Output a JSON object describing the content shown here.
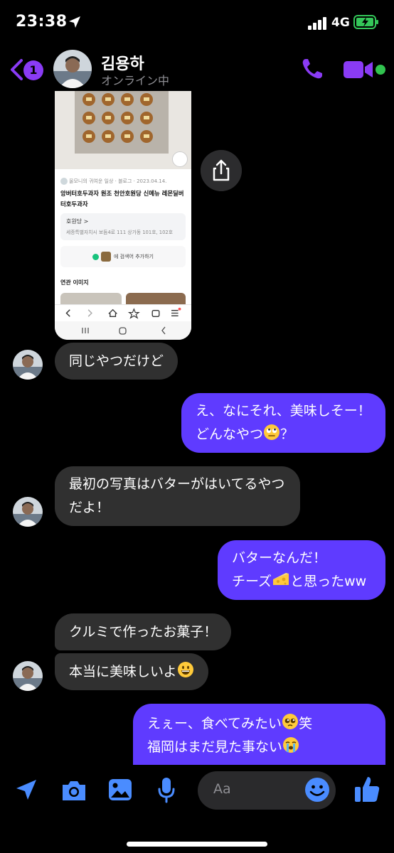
{
  "status": {
    "time": "23:38",
    "network": "4G"
  },
  "header": {
    "unread_count": "1",
    "name": "김용하",
    "presence": "オンライン中"
  },
  "shared_image": {
    "meta": "울모니의 귀여운 일상 · 블로그 · 2023.04.14.",
    "title": "앙버터호두과자 원조 천안호원당 신메뉴 레몬딜버터호두과자",
    "place_name": "호원당 >",
    "place_address": "세종특별자치시 보듬4로 111 상가동 101호, 102호",
    "add_keyword": "에 검색어 추가하기",
    "related": "연관 이미지"
  },
  "messages": [
    {
      "id": "m1",
      "side": "in",
      "text": "同じやつだけど"
    },
    {
      "id": "m2",
      "side": "out",
      "lines": [
        "え、なにそれ、美味しそー！",
        "どんなやつ",
        "？"
      ]
    },
    {
      "id": "m3",
      "side": "in",
      "lines": [
        "最初の写真はバターがはいてるやつ",
        "だよ！"
      ]
    },
    {
      "id": "m4",
      "side": "out",
      "lines": [
        "バターなんだ！",
        "チーズ",
        "と思ったww"
      ]
    },
    {
      "id": "m5",
      "side": "in",
      "text": "クルミで作ったお菓子！"
    },
    {
      "id": "m6",
      "side": "in",
      "text": "本当に美味しいよ"
    },
    {
      "id": "m7",
      "side": "out",
      "lines": [
        "えぇー、食べてみたい",
        "笑",
        "福岡はまだ見た事ない"
      ]
    }
  ],
  "composer": {
    "placeholder": "Aa"
  },
  "colors": {
    "accent": "#8a3bf5",
    "outgoing": "#5f3bff",
    "incoming": "#303030",
    "composer_icon": "#4a8cff"
  },
  "icons": [
    "location-arrow-icon",
    "signal-icon",
    "battery-charging-icon",
    "back-chevron-icon",
    "phone-icon",
    "video-camera-icon",
    "share-icon",
    "send-location-icon",
    "camera-icon",
    "gallery-icon",
    "microphone-icon",
    "emoji-icon",
    "thumbs-up-icon"
  ]
}
